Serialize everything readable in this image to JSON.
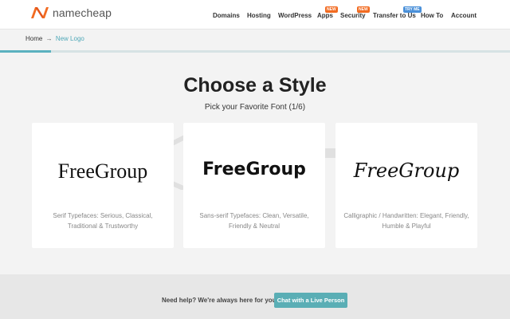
{
  "header": {
    "brand": "namecheap",
    "brand_color": "#f26b21",
    "nav": [
      {
        "label": "Domains"
      },
      {
        "label": "Hosting"
      },
      {
        "label": "WordPress"
      },
      {
        "label": "Apps",
        "badge": "NEW",
        "badge_color": "#f26b21"
      },
      {
        "label": "Security",
        "badge": "NEW",
        "badge_color": "#f26b21"
      },
      {
        "label": "Transfer to Us",
        "badge": "TRY ME",
        "badge_color": "#4a90d9"
      },
      {
        "label": "How To"
      },
      {
        "label": "Account"
      }
    ]
  },
  "breadcrumb": {
    "home": "Home",
    "arrow": "→",
    "current": "New Logo"
  },
  "progress": {
    "fraction": 0.1,
    "color": "#5bb1bf"
  },
  "main": {
    "title": "Choose a Style",
    "subtitle": "Pick your Favorite Font (1/6)"
  },
  "cards": [
    {
      "sample": "FreeGroup",
      "description": "Serif Typefaces: Serious, Classical, Traditional & Trustworthy"
    },
    {
      "sample": "FreeGroup",
      "description": "Sans-serif Typefaces: Clean, Versatile, Friendly & Neutral"
    },
    {
      "sample": "FreeGroup",
      "description": "Calligraphic / Handwritten: Elegant, Friendly, Humble & Playful"
    }
  ],
  "footer": {
    "help_text": "Need help? We're always here for you.",
    "chat_button": "Chat with a Live Person",
    "button_color": "#5aaeb5"
  }
}
